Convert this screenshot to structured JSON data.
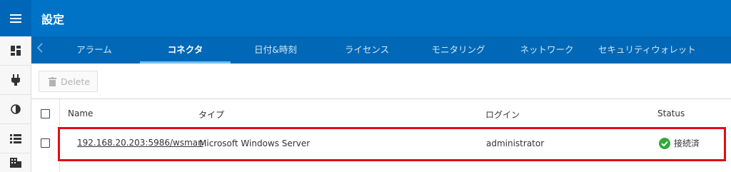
{
  "header": {
    "title": "設定"
  },
  "tabs": {
    "prev_icon": "chevron-left-icon",
    "items": [
      {
        "label": "アラーム"
      },
      {
        "label": "コネクタ",
        "active": true
      },
      {
        "label": "日付&時刻"
      },
      {
        "label": "ライセンス"
      },
      {
        "label": "モニタリング"
      },
      {
        "label": "ネットワーク"
      },
      {
        "label": "セキュリティウォレット"
      }
    ]
  },
  "sidebar": {
    "icons": [
      "menu-icon",
      "dashboard-icon",
      "plug-icon",
      "contrast-icon",
      "list-icon",
      "building-icon"
    ]
  },
  "toolbar": {
    "delete_label": "Delete",
    "delete_icon": "trash-icon"
  },
  "table": {
    "columns": [
      "Name",
      "タイプ",
      "ログイン",
      "Status"
    ],
    "rows": [
      {
        "name": "192.168.20.203:5986/wsman",
        "type": "Microsoft Windows Server",
        "login": "administrator",
        "status": "接続済",
        "status_icon": "check-circle-icon"
      }
    ]
  },
  "colors": {
    "header_bg": "#0073c6",
    "tabs_bg": "#0068b6",
    "highlight_border": "#e00d17",
    "status_ok": "#2eaa3a"
  }
}
